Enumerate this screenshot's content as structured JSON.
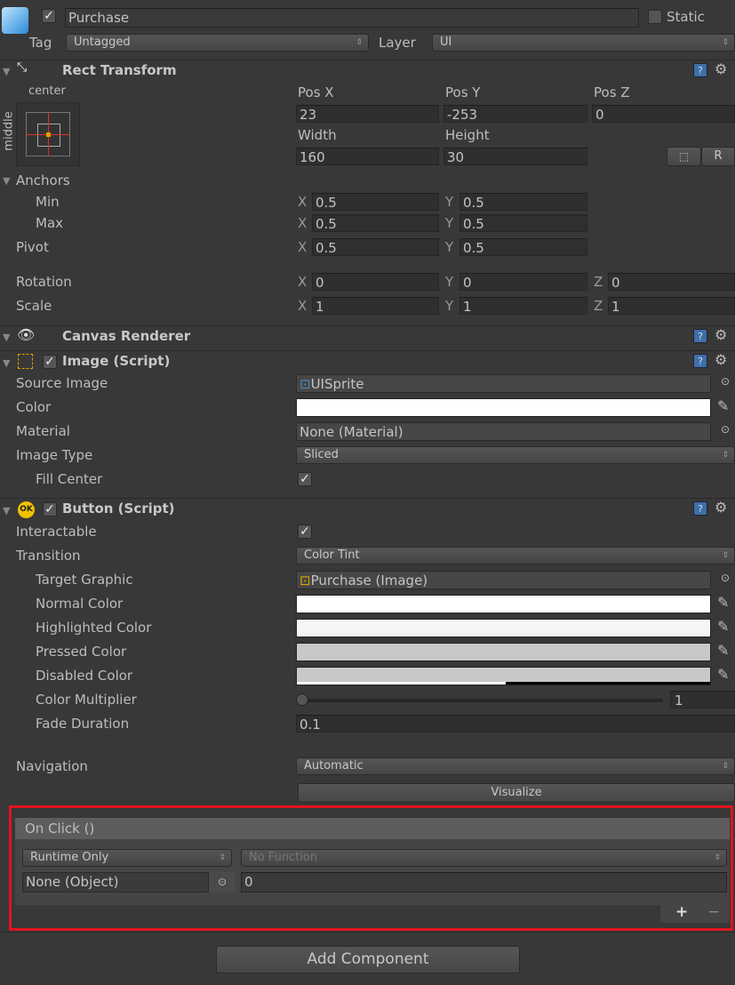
{
  "header": {
    "name": "Purchase",
    "active": true,
    "static_label": "Static",
    "static": false,
    "tag_label": "Tag",
    "tag": "Untagged",
    "layer_label": "Layer",
    "layer": "UI"
  },
  "rect_transform": {
    "title": "Rect Transform",
    "anchor_h": "center",
    "anchor_v": "middle",
    "pos_x_label": "Pos X",
    "pos_y_label": "Pos Y",
    "pos_z_label": "Pos Z",
    "pos_x": "23",
    "pos_y": "-253",
    "pos_z": "0",
    "width_label": "Width",
    "height_label": "Height",
    "width": "160",
    "height": "30",
    "r_label": "R",
    "anchors_label": "Anchors",
    "min_label": "Min",
    "max_label": "Max",
    "pivot_label": "Pivot",
    "rotation_label": "Rotation",
    "scale_label": "Scale",
    "x": "X",
    "y": "Y",
    "z": "Z",
    "min_x": "0.5",
    "min_y": "0.5",
    "max_x": "0.5",
    "max_y": "0.5",
    "pivot_x": "0.5",
    "pivot_y": "0.5",
    "rot_x": "0",
    "rot_y": "0",
    "rot_z": "0",
    "scale_x": "1",
    "scale_y": "1",
    "scale_z": "1"
  },
  "canvas_renderer": {
    "title": "Canvas Renderer"
  },
  "image": {
    "title": "Image (Script)",
    "enabled": true,
    "source_label": "Source Image",
    "source": "UISprite",
    "color_label": "Color",
    "color": "#ffffff",
    "material_label": "Material",
    "material": "None (Material)",
    "type_label": "Image Type",
    "type": "Sliced",
    "fill_label": "Fill Center",
    "fill": true
  },
  "button": {
    "title": "Button (Script)",
    "enabled": true,
    "interactable_label": "Interactable",
    "interactable": true,
    "transition_label": "Transition",
    "transition": "Color Tint",
    "target_label": "Target Graphic",
    "target": "Purchase (Image)",
    "normal_label": "Normal Color",
    "normal": "#ffffff",
    "highlighted_label": "Highlighted Color",
    "highlighted": "#f5f5f5",
    "pressed_label": "Pressed Color",
    "pressed": "#c8c8c8",
    "disabled_label": "Disabled Color",
    "disabled": "#c8c8c8",
    "multiplier_label": "Color Multiplier",
    "multiplier": "1",
    "fade_label": "Fade Duration",
    "fade": "0.1",
    "navigation_label": "Navigation",
    "navigation": "Automatic",
    "visualize": "Visualize",
    "onclick": {
      "title": "On Click ()",
      "mode": "Runtime Only",
      "function": "No Function",
      "object": "None (Object)",
      "arg": "0",
      "add": "+",
      "remove": "−"
    }
  },
  "add_component": "Add Component",
  "colors": {
    "highlight": "#e0141e",
    "background": "#383838"
  }
}
